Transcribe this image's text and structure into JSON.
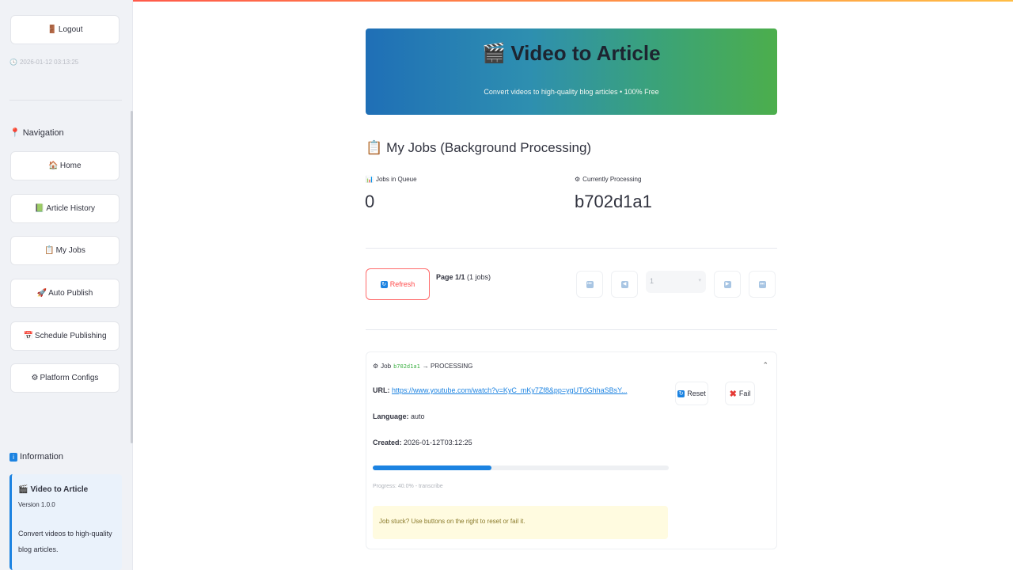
{
  "sidebar": {
    "logout_label": "Logout",
    "timestamp": "2026-01-12 03:13:25",
    "navigation_heading": "Navigation",
    "nav_items": [
      {
        "label": "Home",
        "icon": "🏠"
      },
      {
        "label": "Article History",
        "icon": "📗"
      },
      {
        "label": "My Jobs",
        "icon": "📋"
      },
      {
        "label": "Auto Publish",
        "icon": "🚀"
      },
      {
        "label": "Schedule Publishing",
        "icon": "📅"
      },
      {
        "label": "Platform Configs",
        "icon": "⚙"
      }
    ],
    "information_heading": "Information",
    "info": {
      "title": "Video to Article",
      "version": "Version 1.0.0",
      "description": "Convert videos to high-quality blog articles."
    }
  },
  "banner": {
    "title": "Video to Article",
    "subtitle": "Convert videos to high-quality blog articles • 100% Free"
  },
  "page": {
    "title": "My Jobs (Background Processing)"
  },
  "metrics": {
    "queue_label": "Jobs in Queue",
    "queue_value": "0",
    "processing_label": "Currently Processing",
    "processing_value": "b702d1a1"
  },
  "pagination": {
    "refresh_label": "Refresh",
    "page_bold": "Page 1/1",
    "page_count": "(1 jobs)",
    "current_page": "1"
  },
  "job": {
    "prefix": "Job",
    "id": "b702d1a1",
    "status": "→ PROCESSING",
    "url_label": "URL:",
    "url": "https://www.youtube.com/watch?v=KyC_mKy7Zf8&pp=ygUTdGhhaSBsY...",
    "language_label": "Language:",
    "language": "auto",
    "created_label": "Created:",
    "created": "2026-01-12T03:12:25",
    "progress_percent": 40,
    "progress_text": "Progress: 40.0% - transcribe",
    "warning": "Job stuck? Use buttons on the right to reset or fail it.",
    "reset_label": "Reset",
    "fail_label": "Fail"
  },
  "colors": {
    "accent": "#1c83e1",
    "primary_red": "#ff4b4b",
    "success_green": "#3cb043"
  }
}
